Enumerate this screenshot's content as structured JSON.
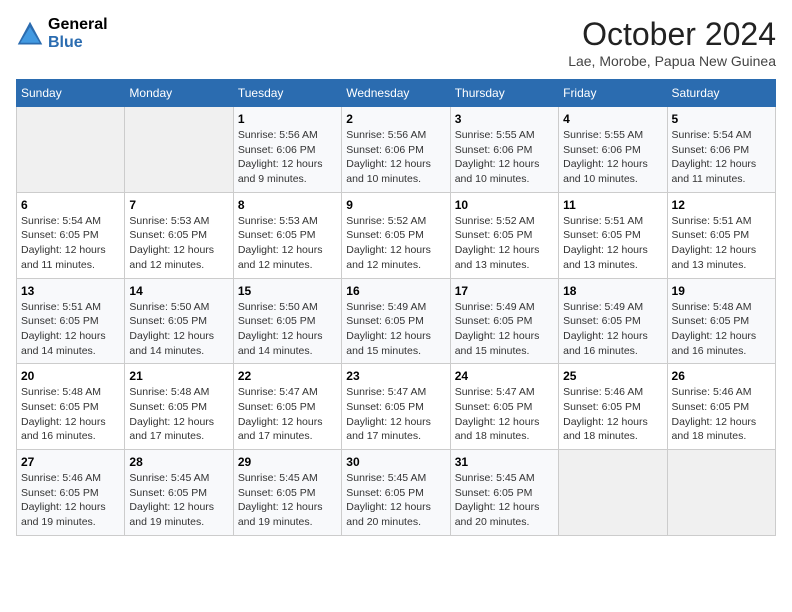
{
  "header": {
    "logo_line1": "General",
    "logo_line2": "Blue",
    "main_title": "October 2024",
    "subtitle": "Lae, Morobe, Papua New Guinea"
  },
  "calendar": {
    "days_of_week": [
      "Sunday",
      "Monday",
      "Tuesday",
      "Wednesday",
      "Thursday",
      "Friday",
      "Saturday"
    ],
    "weeks": [
      [
        {
          "day": "",
          "detail": ""
        },
        {
          "day": "",
          "detail": ""
        },
        {
          "day": "1",
          "detail": "Sunrise: 5:56 AM\nSunset: 6:06 PM\nDaylight: 12 hours\nand 9 minutes."
        },
        {
          "day": "2",
          "detail": "Sunrise: 5:56 AM\nSunset: 6:06 PM\nDaylight: 12 hours\nand 10 minutes."
        },
        {
          "day": "3",
          "detail": "Sunrise: 5:55 AM\nSunset: 6:06 PM\nDaylight: 12 hours\nand 10 minutes."
        },
        {
          "day": "4",
          "detail": "Sunrise: 5:55 AM\nSunset: 6:06 PM\nDaylight: 12 hours\nand 10 minutes."
        },
        {
          "day": "5",
          "detail": "Sunrise: 5:54 AM\nSunset: 6:06 PM\nDaylight: 12 hours\nand 11 minutes."
        }
      ],
      [
        {
          "day": "6",
          "detail": "Sunrise: 5:54 AM\nSunset: 6:05 PM\nDaylight: 12 hours\nand 11 minutes."
        },
        {
          "day": "7",
          "detail": "Sunrise: 5:53 AM\nSunset: 6:05 PM\nDaylight: 12 hours\nand 12 minutes."
        },
        {
          "day": "8",
          "detail": "Sunrise: 5:53 AM\nSunset: 6:05 PM\nDaylight: 12 hours\nand 12 minutes."
        },
        {
          "day": "9",
          "detail": "Sunrise: 5:52 AM\nSunset: 6:05 PM\nDaylight: 12 hours\nand 12 minutes."
        },
        {
          "day": "10",
          "detail": "Sunrise: 5:52 AM\nSunset: 6:05 PM\nDaylight: 12 hours\nand 13 minutes."
        },
        {
          "day": "11",
          "detail": "Sunrise: 5:51 AM\nSunset: 6:05 PM\nDaylight: 12 hours\nand 13 minutes."
        },
        {
          "day": "12",
          "detail": "Sunrise: 5:51 AM\nSunset: 6:05 PM\nDaylight: 12 hours\nand 13 minutes."
        }
      ],
      [
        {
          "day": "13",
          "detail": "Sunrise: 5:51 AM\nSunset: 6:05 PM\nDaylight: 12 hours\nand 14 minutes."
        },
        {
          "day": "14",
          "detail": "Sunrise: 5:50 AM\nSunset: 6:05 PM\nDaylight: 12 hours\nand 14 minutes."
        },
        {
          "day": "15",
          "detail": "Sunrise: 5:50 AM\nSunset: 6:05 PM\nDaylight: 12 hours\nand 14 minutes."
        },
        {
          "day": "16",
          "detail": "Sunrise: 5:49 AM\nSunset: 6:05 PM\nDaylight: 12 hours\nand 15 minutes."
        },
        {
          "day": "17",
          "detail": "Sunrise: 5:49 AM\nSunset: 6:05 PM\nDaylight: 12 hours\nand 15 minutes."
        },
        {
          "day": "18",
          "detail": "Sunrise: 5:49 AM\nSunset: 6:05 PM\nDaylight: 12 hours\nand 16 minutes."
        },
        {
          "day": "19",
          "detail": "Sunrise: 5:48 AM\nSunset: 6:05 PM\nDaylight: 12 hours\nand 16 minutes."
        }
      ],
      [
        {
          "day": "20",
          "detail": "Sunrise: 5:48 AM\nSunset: 6:05 PM\nDaylight: 12 hours\nand 16 minutes."
        },
        {
          "day": "21",
          "detail": "Sunrise: 5:48 AM\nSunset: 6:05 PM\nDaylight: 12 hours\nand 17 minutes."
        },
        {
          "day": "22",
          "detail": "Sunrise: 5:47 AM\nSunset: 6:05 PM\nDaylight: 12 hours\nand 17 minutes."
        },
        {
          "day": "23",
          "detail": "Sunrise: 5:47 AM\nSunset: 6:05 PM\nDaylight: 12 hours\nand 17 minutes."
        },
        {
          "day": "24",
          "detail": "Sunrise: 5:47 AM\nSunset: 6:05 PM\nDaylight: 12 hours\nand 18 minutes."
        },
        {
          "day": "25",
          "detail": "Sunrise: 5:46 AM\nSunset: 6:05 PM\nDaylight: 12 hours\nand 18 minutes."
        },
        {
          "day": "26",
          "detail": "Sunrise: 5:46 AM\nSunset: 6:05 PM\nDaylight: 12 hours\nand 18 minutes."
        }
      ],
      [
        {
          "day": "27",
          "detail": "Sunrise: 5:46 AM\nSunset: 6:05 PM\nDaylight: 12 hours\nand 19 minutes."
        },
        {
          "day": "28",
          "detail": "Sunrise: 5:45 AM\nSunset: 6:05 PM\nDaylight: 12 hours\nand 19 minutes."
        },
        {
          "day": "29",
          "detail": "Sunrise: 5:45 AM\nSunset: 6:05 PM\nDaylight: 12 hours\nand 19 minutes."
        },
        {
          "day": "30",
          "detail": "Sunrise: 5:45 AM\nSunset: 6:05 PM\nDaylight: 12 hours\nand 20 minutes."
        },
        {
          "day": "31",
          "detail": "Sunrise: 5:45 AM\nSunset: 6:05 PM\nDaylight: 12 hours\nand 20 minutes."
        },
        {
          "day": "",
          "detail": ""
        },
        {
          "day": "",
          "detail": ""
        }
      ]
    ]
  }
}
